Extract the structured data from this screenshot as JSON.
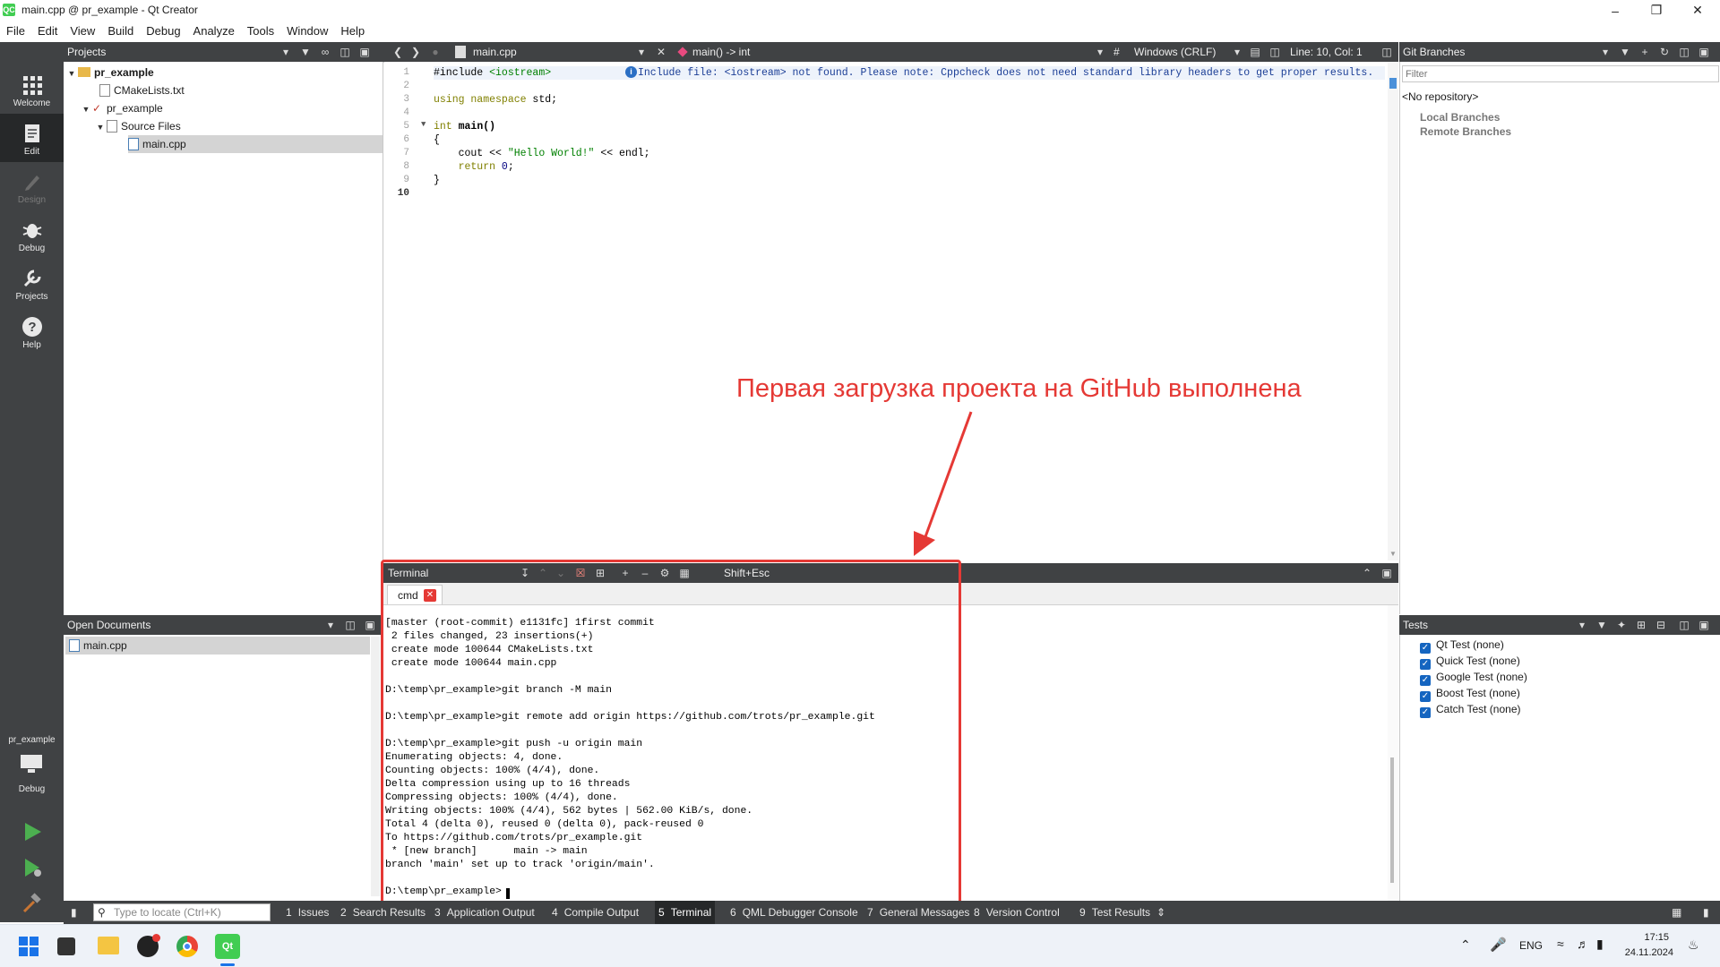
{
  "window": {
    "title": "main.cpp @ pr_example - Qt Creator",
    "app_icon_text": "QC"
  },
  "menu": [
    "File",
    "Edit",
    "View",
    "Build",
    "Debug",
    "Analyze",
    "Tools",
    "Window",
    "Help"
  ],
  "modes": [
    {
      "label": "Welcome",
      "icon": "grid-icon",
      "active": false
    },
    {
      "label": "Edit",
      "icon": "edit-doc-icon",
      "active": true
    },
    {
      "label": "Design",
      "icon": "pencil-icon",
      "active": false
    },
    {
      "label": "Debug",
      "icon": "bug-icon",
      "active": false
    },
    {
      "label": "Projects",
      "icon": "wrench-icon",
      "active": false
    },
    {
      "label": "Help",
      "icon": "help-icon",
      "active": false
    }
  ],
  "kit": {
    "project": "pr_example",
    "config": "Debug"
  },
  "projects_pane": {
    "title": "Projects",
    "tree": [
      {
        "label": "pr_example",
        "bold": true
      },
      {
        "label": "CMakeLists.txt"
      },
      {
        "label": "pr_example"
      },
      {
        "label": "Source Files"
      },
      {
        "label": "main.cpp",
        "selected": true
      }
    ]
  },
  "open_docs": {
    "title": "Open Documents",
    "items": [
      "main.cpp"
    ]
  },
  "editor": {
    "file_tab": "main.cpp",
    "function": "main() -> int",
    "line_ending": "Windows (CRLF)",
    "position": "Line: 10, Col: 1",
    "hint": "Include file: <iostream> not found. Please note: Cppcheck does not need standard library headers to get proper results.",
    "line_numbers": [
      "1",
      "2",
      "3",
      "4",
      "5",
      "6",
      "7",
      "8",
      "9",
      "10"
    ],
    "lines": {
      "l1_a": "#include ",
      "l1_b": "<iostream>",
      "l3_a": "using namespace ",
      "l3_b": "std;",
      "l5_a": "int ",
      "l5_b": "main()",
      "l6": "{",
      "l7_a": "    cout << ",
      "l7_b": "\"Hello World!\"",
      "l7_c": " << endl;",
      "l8_a": "    return ",
      "l8_b": "0",
      "l8_c": ";",
      "l9": "}"
    }
  },
  "git_pane": {
    "title": "Git Branches",
    "filter_placeholder": "Filter",
    "repo": "<No repository>",
    "branches": [
      "Local Branches",
      "Remote Branches"
    ]
  },
  "tests_pane": {
    "title": "Tests",
    "items": [
      "Qt Test (none)",
      "Quick Test (none)",
      "Google Test (none)",
      "Boost Test (none)",
      "Catch Test (none)"
    ]
  },
  "terminal": {
    "title": "Terminal",
    "shortcut": "Shift+Esc",
    "tab": "cmd",
    "lines": [
      "[master (root-commit) e1131fc] 1first commit",
      " 2 files changed, 23 insertions(+)",
      " create mode 100644 CMakeLists.txt",
      " create mode 100644 main.cpp",
      "",
      "D:\\temp\\pr_example>git branch -M main",
      "",
      "D:\\temp\\pr_example>git remote add origin https://github.com/trots/pr_example.git",
      "",
      "D:\\temp\\pr_example>git push -u origin main",
      "Enumerating objects: 4, done.",
      "Counting objects: 100% (4/4), done.",
      "Delta compression using up to 16 threads",
      "Compressing objects: 100% (4/4), done.",
      "Writing objects: 100% (4/4), 562 bytes | 562.00 KiB/s, done.",
      "Total 4 (delta 0), reused 0 (delta 0), pack-reused 0",
      "To https://github.com/trots/pr_example.git",
      " * [new branch]      main -> main",
      "branch 'main' set up to track 'origin/main'.",
      "",
      "D:\\temp\\pr_example>"
    ]
  },
  "annotation": {
    "text": "Первая загрузка проекта на GitHub выполнена",
    "color": "#e53935"
  },
  "output_bar": {
    "locator_placeholder": "Type to locate (Ctrl+K)",
    "tabs": [
      {
        "num": "1",
        "label": "Issues"
      },
      {
        "num": "2",
        "label": "Search Results"
      },
      {
        "num": "3",
        "label": "Application Output"
      },
      {
        "num": "4",
        "label": "Compile Output"
      },
      {
        "num": "5",
        "label": "Terminal",
        "active": true
      },
      {
        "num": "6",
        "label": "QML Debugger Console"
      },
      {
        "num": "7",
        "label": "General Messages"
      },
      {
        "num": "8",
        "label": "Version Control"
      },
      {
        "num": "9",
        "label": "Test Results"
      }
    ]
  },
  "taskbar": {
    "lang": "ENG",
    "time": "17:15",
    "date": "24.11.2024"
  }
}
